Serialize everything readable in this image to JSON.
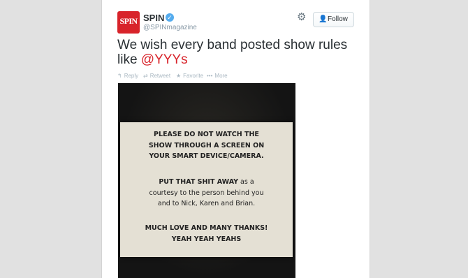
{
  "account": {
    "avatar_text": "SPIN",
    "name": "SPIN",
    "verified_glyph": "✓",
    "handle": "@SPINmagazine",
    "brand_color": "#d8232a"
  },
  "header": {
    "gear_icon": "gear-icon",
    "follow_label": "Follow"
  },
  "tweet": {
    "text_before": "We wish every band posted show rules like ",
    "mention": "@YYYs"
  },
  "actions": {
    "reply": "Reply",
    "retweet": "Retweet",
    "favorite": "Favorite",
    "more": "More"
  },
  "sign": {
    "line1": "PLEASE DO NOT WATCH THE",
    "line2": "SHOW THROUGH A SCREEN ON",
    "line3": "YOUR SMART DEVICE/CAMERA.",
    "line4_bold": "PUT THAT SHIT AWAY",
    "line4_rest": " as a",
    "line5": "courtesy to the person behind you",
    "line6": "and to Nick, Karen and Brian.",
    "line7": "MUCH LOVE AND MANY THANKS!",
    "line8": "YEAH YEAH YEAHS"
  }
}
